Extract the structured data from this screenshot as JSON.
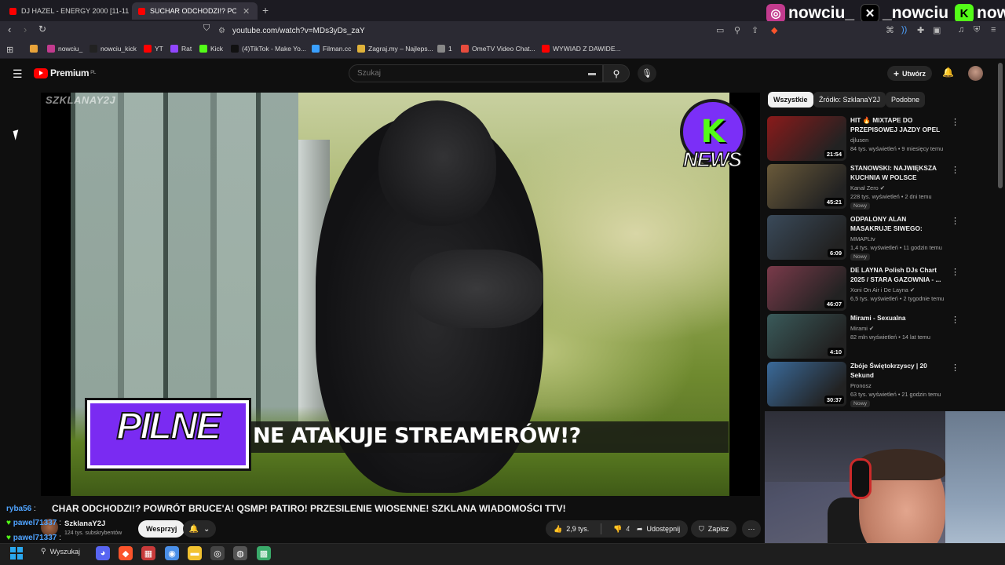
{
  "browser": {
    "tabs": [
      {
        "title": "DJ HAZEL - ENERGY 2000 [11-11",
        "active": false
      },
      {
        "title": "SUCHAR ODCHODZI!? POWR",
        "active": true
      }
    ],
    "new_tab": "+",
    "url": "youtube.com/watch?v=MDs3yDs_zaY",
    "bookmarks": [
      {
        "label": "",
        "icon": "folder-icon",
        "color": "#e8a33a"
      },
      {
        "label": "nowciu_",
        "icon": "instagram-icon",
        "color": "#c23b8e"
      },
      {
        "label": "nowciu_kick",
        "icon": "x-icon",
        "color": "#222222"
      },
      {
        "label": "YT",
        "icon": "youtube-icon",
        "color": "#ff0000"
      },
      {
        "label": "Rat",
        "icon": "twitch-icon",
        "color": "#9146ff"
      },
      {
        "label": "Kick",
        "icon": "kick-icon",
        "color": "#53fc18"
      },
      {
        "label": "(4)TikTok - Make Yo...",
        "icon": "tiktok-icon",
        "color": "#111111"
      },
      {
        "label": "Filman.cc",
        "icon": "filman-icon",
        "color": "#3aa0ff"
      },
      {
        "label": "Zagraj.my – Najleps...",
        "icon": "zagraj-icon",
        "color": "#e0b23a"
      },
      {
        "label": "1",
        "icon": "vpn-icon",
        "color": "#888888"
      },
      {
        "label": "OmeTV Video Chat...",
        "icon": "ometv-icon",
        "color": "#e84c3d"
      },
      {
        "label": "WYWIAD Z DAWIDE...",
        "icon": "youtube-icon",
        "color": "#ff0000"
      }
    ]
  },
  "social_overlay": [
    {
      "icon": "instagram-icon",
      "handle": "nowciu_"
    },
    {
      "icon": "x-icon",
      "handle": "_nowciu"
    },
    {
      "icon": "kick-icon",
      "handle": "nowciu"
    }
  ],
  "youtube": {
    "logo_text": "Premium",
    "logo_region": "PL",
    "search_placeholder": "Szukaj",
    "create_label": "Utwórz",
    "chips": [
      "Wszystkie",
      "Źródło: SzklanaY2J",
      "Podobne"
    ],
    "active_chip": "Wszystkie"
  },
  "video": {
    "watermark": "SZKLANAY2J",
    "news_badge": "NEWS",
    "pilne": "PILNE",
    "headline": "NE ATAKUJE STREAMERÓW!?",
    "title": "CHAR ODCHODZI!? POWRÓT BRUCE'A! QSMP! PATIRO! PRZESILENIE WIOSENNE! SZKLANA WIADOMOŚCI TTV!",
    "channel": "SzklanaY2J",
    "subscribers": "124 tys. subskrybentów",
    "support_label": "Wesprzyj",
    "likes": "2,9 tys.",
    "dislikes": "43",
    "share_label": "Udostępnij",
    "save_label": "Zapisz"
  },
  "chat": [
    {
      "user": "ryba56",
      "text": ":",
      "color": "#4fa3ff"
    },
    {
      "user": "pawel71337",
      "text": ":",
      "color": "#4fa3ff"
    },
    {
      "user": "pawel71337",
      "text": ":",
      "color": "#4fa3ff"
    }
  ],
  "recommended": [
    {
      "title": "HIT 🔥 MIXTAPE DO PRZEPISOWEJ JAZDY OPEL ...",
      "channel": "djlusen",
      "meta": "84 tys. wyświetleń • 9 miesięcy temu",
      "duration": "21:54",
      "badge": "",
      "verified": false,
      "thumb": "#8a1a1a"
    },
    {
      "title": "STANOWSKI: NAJWIĘKSZA KUCHNIA W POLSCE",
      "channel": "Kanał Zero",
      "meta": "228 tys. wyświetleń • 2 dni temu",
      "duration": "45:21",
      "badge": "Nowy",
      "verified": true,
      "thumb": "#6a5a3a"
    },
    {
      "title": "ODPALONY ALAN MASAKRUJE SIWEGO: DALEJ NIE MA JAJ, ...",
      "channel": "MMAPLtv",
      "meta": "1,4 tys. wyświetleń • 11 godzin temu",
      "duration": "6:09",
      "badge": "Nowy",
      "verified": false,
      "thumb": "#3a4a5a"
    },
    {
      "title": "DE LAYNA Polish DJs Chart 2025 / STARA GAZOWNIA - ...",
      "channel": "Xoni On Air i De Layna",
      "meta": "6,5 tys. wyświetleń • 2 tygodnie temu",
      "duration": "46:07",
      "badge": "",
      "verified": true,
      "thumb": "#7a3a4a"
    },
    {
      "title": "Mirami - Sexualna",
      "channel": "Mirami",
      "meta": "82 mln wyświetleń • 14 lat temu",
      "duration": "4:10",
      "badge": "",
      "verified": true,
      "thumb": "#3a5a5a"
    },
    {
      "title": "Zbóje Świętokrzyscy | 20 Sekund",
      "channel": "Pronosz",
      "meta": "63 tys. wyświetleń • 21 godzin temu",
      "duration": "30:37",
      "badge": "Nowy",
      "verified": false,
      "thumb": "#3a6a9a"
    }
  ],
  "taskbar": {
    "search_label": "Wyszukaj",
    "apps": [
      {
        "icon": "discord-icon",
        "color": "#5865f2"
      },
      {
        "icon": "brave-icon",
        "color": "#fb542b"
      },
      {
        "icon": "app-icon",
        "color": "#c83a3a"
      },
      {
        "icon": "chrome-icon",
        "color": "#4a8fe8"
      },
      {
        "icon": "folder-icon",
        "color": "#f2c230"
      },
      {
        "icon": "obs-icon",
        "color": "#444444"
      },
      {
        "icon": "streamlabs-icon",
        "color": "#555555"
      },
      {
        "icon": "game-icon",
        "color": "#3aaa6a"
      }
    ]
  },
  "colors": {
    "yt_red": "#ff0000",
    "pilne_purple": "#7a2bf2",
    "kick_green": "#53fc18"
  }
}
